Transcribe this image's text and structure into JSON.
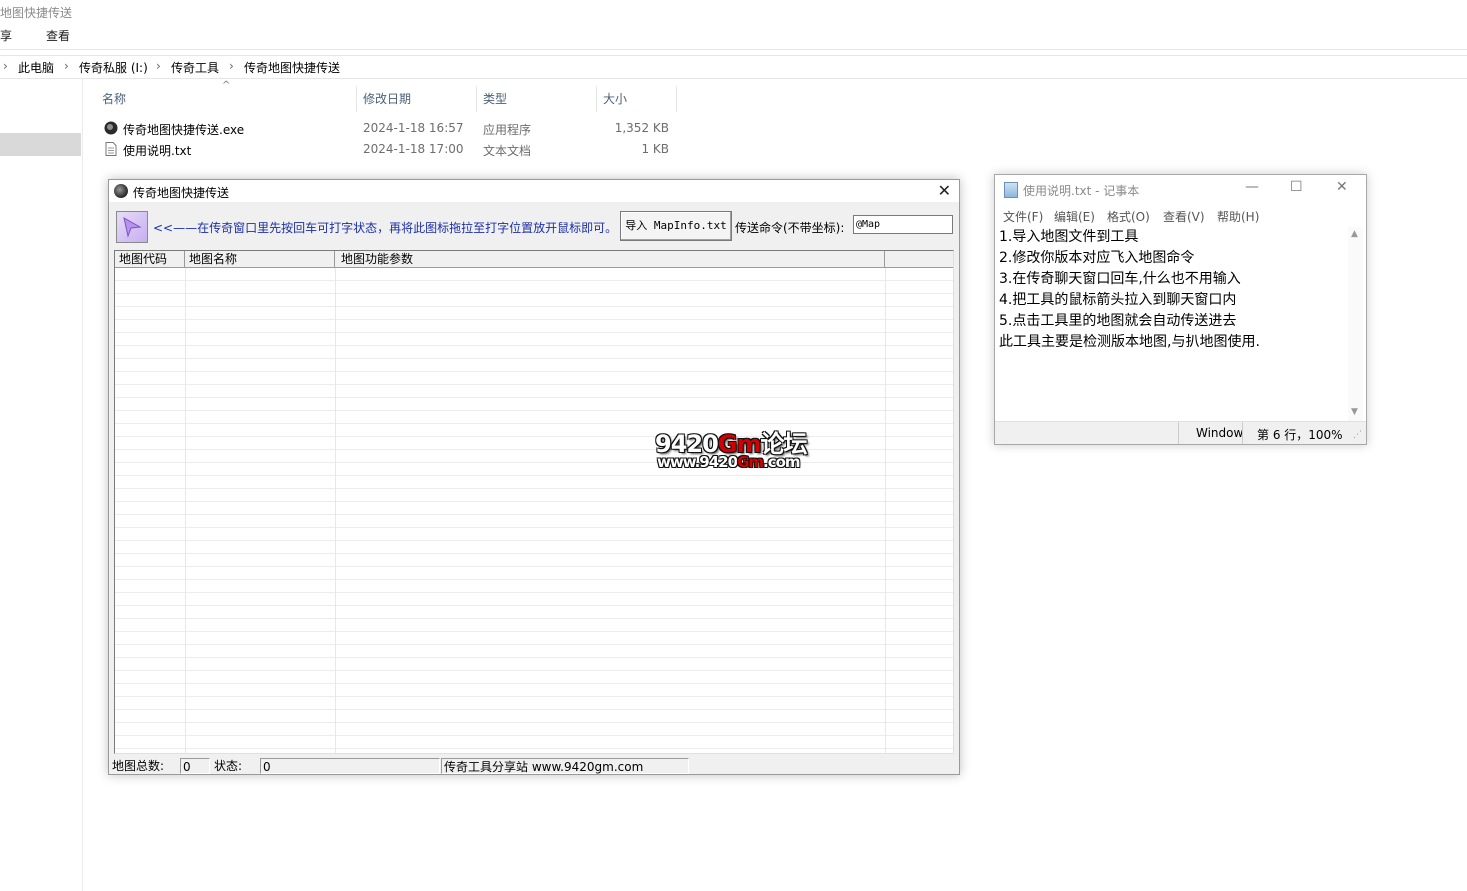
{
  "explorer": {
    "title": "地图快捷传送",
    "ribbon_tabs": [
      "享",
      "查看"
    ],
    "breadcrumb": [
      "此电脑",
      "传奇私服 (I:)",
      "传奇工具",
      "传奇地图快捷传送"
    ],
    "columns": [
      "名称",
      "修改日期",
      "类型",
      "大小"
    ],
    "files": [
      {
        "name": "传奇地图快捷传送.exe",
        "date": "2024-1-18 16:57",
        "type": "应用程序",
        "size": "1,352 KB",
        "icon": "app-icon"
      },
      {
        "name": "使用说明.txt",
        "date": "2024-1-18 17:00",
        "type": "文本文档",
        "size": "1 KB",
        "icon": "text-file-icon"
      }
    ]
  },
  "app": {
    "title": "传奇地图快捷传送",
    "hint": "<<——在传奇窗口里先按回车可打字状态，再将此图标拖拉至打字位置放开鼠标即可。",
    "import_button": "导入 MapInfo.txt",
    "command_label": "传送命令(不带坐标):",
    "command_value": "@Map",
    "list_columns": [
      "地图代码",
      "地图名称",
      "地图功能参数",
      ""
    ],
    "watermark": {
      "line1_a": "9420",
      "line1_b": "Gm",
      "line1_c": "论坛",
      "line2_a": "www.9420",
      "line2_b": "Gm",
      "line2_c": ".com"
    },
    "status": {
      "map_count_label": "地图总数:",
      "map_count": "0",
      "state_label": "状态:",
      "state_value": "0",
      "site": "传奇工具分享站 www.9420gm.com"
    }
  },
  "notepad": {
    "title": "使用说明.txt - 记事本",
    "menu": [
      "文件(F)",
      "编辑(E)",
      "格式(O)",
      "查看(V)",
      "帮助(H)"
    ],
    "lines": [
      "1.导入地图文件到工具",
      "2.修改你版本对应飞入地图命令",
      "3.在传奇聊天窗口回车,什么也不用输入",
      "4.把工具的鼠标箭头拉入到聊天窗口内",
      "5.点击工具里的地图就会自动传送进去",
      "此工具主要是检测版本地图,与扒地图使用."
    ],
    "status": {
      "encoding": "Window",
      "position": "第 6 行，100%"
    }
  }
}
